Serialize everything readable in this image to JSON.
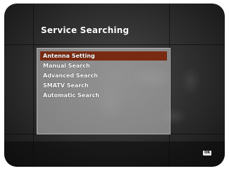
{
  "screen": {
    "title": "Service Searching"
  },
  "menu": {
    "items": [
      {
        "label": "Antenna Setting",
        "selected": true
      },
      {
        "label": "Manual Search",
        "selected": false
      },
      {
        "label": "Advanced Search",
        "selected": false
      },
      {
        "label": "SMATV Search",
        "selected": false
      },
      {
        "label": "Automatic Search",
        "selected": false
      }
    ]
  },
  "footer": {
    "ok_badge": "OK"
  },
  "colors": {
    "selection": "#7a2a10",
    "panel": "#cdcdcd",
    "background": "#2c2c2c"
  }
}
